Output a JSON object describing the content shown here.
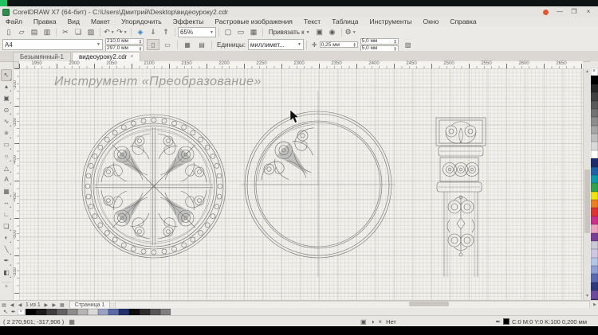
{
  "frame": {
    "accent_color": "#1fc25e"
  },
  "window": {
    "title": "CorelDRAW X7 (64-бит) - C:\\Users\\Дмитрий\\Desktop\\видеоуроку2.cdr",
    "buttons": {
      "minimize": "—",
      "maximize": "❐",
      "close": "×"
    }
  },
  "menubar": {
    "items": [
      {
        "name": "file",
        "label": "Файл"
      },
      {
        "name": "edit",
        "label": "Правка"
      },
      {
        "name": "view",
        "label": "Вид"
      },
      {
        "name": "layout",
        "label": "Макет"
      },
      {
        "name": "arrange",
        "label": "Упорядочить"
      },
      {
        "name": "effects",
        "label": "Эффекты"
      },
      {
        "name": "bitmaps",
        "label": "Растровые изображения"
      },
      {
        "name": "text",
        "label": "Текст"
      },
      {
        "name": "table",
        "label": "Таблица"
      },
      {
        "name": "tools",
        "label": "Инструменты"
      },
      {
        "name": "window",
        "label": "Окно"
      },
      {
        "name": "help",
        "label": "Справка"
      }
    ]
  },
  "toolbar": {
    "zoom_value": "65%",
    "snap_label": "Привязать к",
    "items": [
      {
        "kind": "btn",
        "name": "new-document",
        "glyph": "▯"
      },
      {
        "kind": "btn",
        "name": "open",
        "glyph": "▱"
      },
      {
        "kind": "btn",
        "name": "save",
        "glyph": "▤"
      },
      {
        "kind": "btn",
        "name": "print",
        "glyph": "▥"
      },
      {
        "kind": "sep"
      },
      {
        "kind": "btn",
        "name": "cut",
        "glyph": "✂"
      },
      {
        "kind": "btn",
        "name": "copy",
        "glyph": "❏"
      },
      {
        "kind": "btn",
        "name": "paste",
        "glyph": "▨"
      },
      {
        "kind": "sep"
      },
      {
        "kind": "btn",
        "name": "undo",
        "glyph": "↶",
        "caret": true
      },
      {
        "kind": "btn",
        "name": "redo",
        "glyph": "↷",
        "caret": true
      },
      {
        "kind": "sep"
      },
      {
        "kind": "btn",
        "name": "search-content",
        "glyph": "◈",
        "color": "#2e7fc2"
      },
      {
        "kind": "btn",
        "name": "import",
        "glyph": "⇓"
      },
      {
        "kind": "btn",
        "name": "export",
        "glyph": "⇑"
      },
      {
        "kind": "sep"
      },
      {
        "kind": "zoom"
      },
      {
        "kind": "sep"
      },
      {
        "kind": "btn",
        "name": "fullscreen-preview",
        "glyph": "▢"
      },
      {
        "kind": "btn",
        "name": "show-rulers",
        "glyph": "▭"
      },
      {
        "kind": "btn",
        "name": "show-grid",
        "glyph": "▦"
      },
      {
        "kind": "sep"
      },
      {
        "kind": "snap"
      },
      {
        "kind": "btn",
        "name": "welcome-screen",
        "glyph": "▣"
      },
      {
        "kind": "btn",
        "name": "whats-new",
        "glyph": "◉"
      },
      {
        "kind": "sep"
      },
      {
        "kind": "btn",
        "name": "options",
        "glyph": "⚙",
        "caret": true
      }
    ]
  },
  "property_bar": {
    "page_size": "A4",
    "page_width": "210,0 мм",
    "page_height": "297,0 мм",
    "portrait_glyph": "▯",
    "landscape_glyph": "▭",
    "all_pages_glyph": "▦",
    "current_page_glyph": "▤",
    "units_label": "Единицы:",
    "units_value": "миллимет...",
    "nudge_value": "0,25 мм",
    "duplicate_x": "5,0 мм",
    "duplicate_y": "5,0 мм"
  },
  "document_tabs": {
    "tabs": [
      {
        "label": "Безымянный-1",
        "active": false
      },
      {
        "label": "видеоуроку2.cdr",
        "active": true
      }
    ],
    "close_glyph": "×"
  },
  "rulers": {
    "top_labels": [
      "1950",
      "2000",
      "2050",
      "2100",
      "2150",
      "2200",
      "2250",
      "2300",
      "2350",
      "2400",
      "2450",
      "2500",
      "2550",
      "2600",
      "2650"
    ],
    "left_labels": [
      "-300",
      "-350",
      "-400",
      "-450",
      "-500",
      "-550"
    ]
  },
  "toolbox": {
    "tools": [
      {
        "name": "pick-tool",
        "glyph": "↖",
        "active": true
      },
      {
        "name": "shape-tool",
        "glyph": "▴"
      },
      {
        "name": "crop-tool",
        "glyph": "▣"
      },
      {
        "name": "zoom-tool",
        "glyph": "⊙"
      },
      {
        "name": "freehand-tool",
        "glyph": "∿"
      },
      {
        "name": "smart-fill-tool",
        "glyph": "✳"
      },
      {
        "name": "rectangle-tool",
        "glyph": "▭"
      },
      {
        "name": "ellipse-tool",
        "glyph": "○"
      },
      {
        "name": "polygon-tool",
        "glyph": "△"
      },
      {
        "name": "text-tool",
        "glyph": "А"
      },
      {
        "name": "table-tool",
        "glyph": "▦"
      },
      {
        "name": "dimension-tool",
        "glyph": "↔"
      },
      {
        "name": "connector-tool",
        "glyph": "∟"
      },
      {
        "name": "drop-shadow-tool",
        "glyph": "❏"
      },
      {
        "name": "transparency-tool",
        "glyph": "◐"
      },
      {
        "name": "color-eyedropper-tool",
        "glyph": "╲"
      },
      {
        "name": "outline-pen-tool",
        "glyph": "✒"
      },
      {
        "name": "interactive-fill-tool",
        "glyph": "◧"
      }
    ],
    "add_tools_glyph": "+"
  },
  "canvas": {
    "heading": "Инструмент «Преобразование»"
  },
  "palette": {
    "no_color_glyph": "×",
    "colors": [
      "#000000",
      "#262626",
      "#404040",
      "#595959",
      "#737373",
      "#8c8c8c",
      "#a6a6a6",
      "#bfbfbf",
      "#d9d9d9",
      "#ffffff",
      "#1b2e6b",
      "#2062a8",
      "#0b9bab",
      "#2fa24c",
      "#f2e30e",
      "#ef7f1a",
      "#e03131",
      "#cf2e8e",
      "#efa3c3",
      "#7c3f98",
      "#c9c9d9",
      "#cfc6e6",
      "#b4c6e8",
      "#8e9fd6",
      "#5a6ab3",
      "#2e3a7e",
      "#6b4a9e",
      "#3d2a66"
    ],
    "scroll_down_glyph": "▼",
    "flyout_glyph": "»"
  },
  "document_palette": {
    "no_color_glyph": "×",
    "colors": [
      "#000000",
      "#1c1c1c",
      "#3f3f3f",
      "#636363",
      "#8c8c8c",
      "#b5b5b5",
      "#d9d9d9",
      "#9aa3c4",
      "#5b6aa6",
      "#23306b",
      "#0d0d0d",
      "#2e2e2e",
      "#575757",
      "#808080"
    ]
  },
  "page_controls": {
    "add_page_glyph": "▤",
    "first_glyph": "◀",
    "prev_glyph": "◀",
    "count_text": "1 из 1",
    "next_glyph": "▶",
    "last_glyph": "▶",
    "options_glyph": "▦",
    "page_tab": "Страница 1"
  },
  "status_bar": {
    "cursor_position": "( 2 270,901; -317,906 )",
    "doc_info_glyph": "▦",
    "mid_icons": {
      "object_glyph": "▣",
      "fill_glyph": "◑",
      "none_glyph": "×"
    },
    "fill_status": "Нет",
    "outline_pen_glyph": "✒",
    "outline_color": "#000000",
    "outline_info": "C:0 M:0 Y:0 K:100  0,200 мм"
  }
}
